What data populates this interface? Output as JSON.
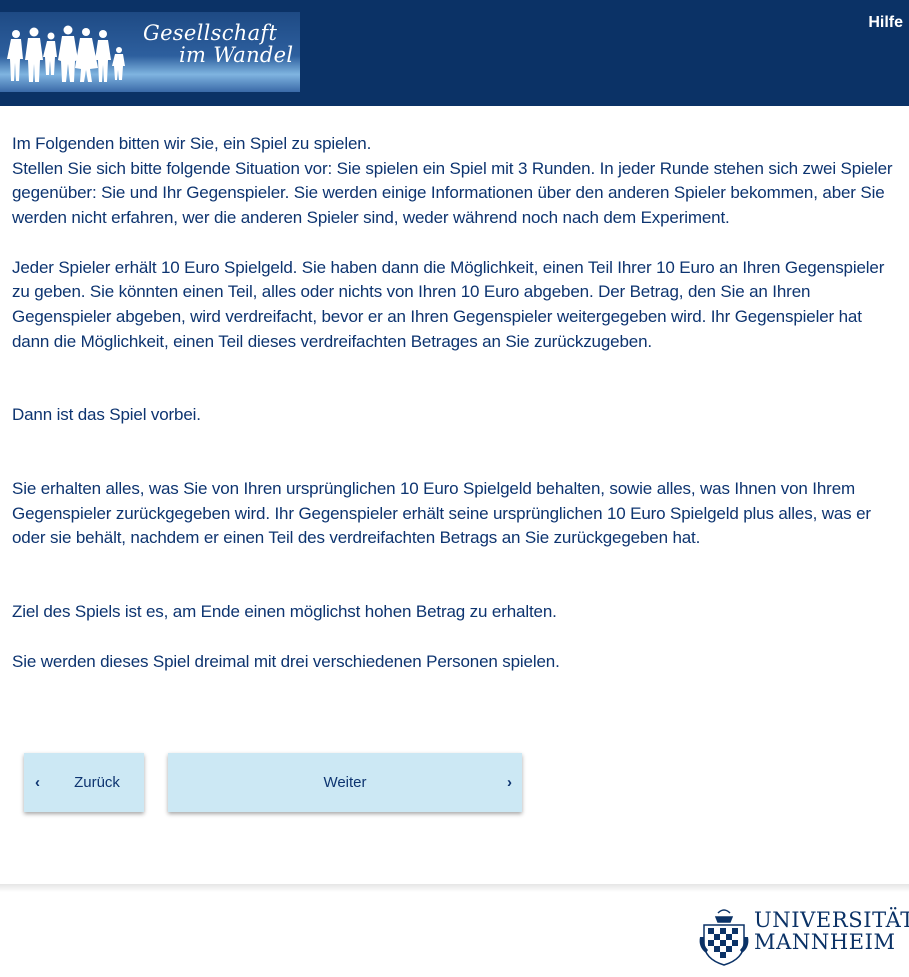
{
  "header": {
    "logo_line1": "Gesellschaft",
    "logo_line2": "im Wandel",
    "help_link": "Hilfe"
  },
  "content": {
    "p1": "Im Folgenden bitten wir Sie, ein Spiel zu spielen.",
    "p2": "Stellen Sie sich bitte folgende Situation vor: Sie spielen ein Spiel mit 3 Runden. In jeder Runde stehen sich zwei Spieler gegenüber: Sie und Ihr Gegenspieler. Sie werden einige Informationen über den anderen Spieler bekommen, aber Sie werden nicht erfahren, wer die anderen Spieler sind, weder während noch nach dem Experiment.",
    "p3": "Jeder Spieler erhält 10 Euro Spielgeld. Sie haben dann die Möglichkeit, einen Teil Ihrer 10 Euro an Ihren Gegenspieler zu geben. Sie könnten einen Teil, alles oder nichts von Ihren 10 Euro abgeben. Der Betrag, den Sie an Ihren Gegenspieler abgeben, wird verdreifacht, bevor er an Ihren Gegenspieler weitergegeben wird. Ihr Gegenspieler hat dann die Möglichkeit, einen Teil dieses verdreifachten Betrages an Sie zurückzugeben.",
    "p4": "Dann ist das Spiel vorbei.",
    "p5": "Sie erhalten alles, was Sie von Ihren ursprünglichen 10 Euro Spielgeld behalten, sowie alles, was Ihnen von Ihrem Gegenspieler zurückgegeben wird. Ihr Gegenspieler erhält seine ursprünglichen 10 Euro Spielgeld plus alles, was er oder sie behält, nachdem er einen Teil des verdreifachten Betrags an Sie zurückgegeben hat.",
    "p6": "Ziel des Spiels ist es, am Ende einen möglichst hohen Betrag zu erhalten.",
    "p7": "Sie werden dieses Spiel dreimal mit drei verschiedenen Personen spielen."
  },
  "nav": {
    "back_label": "Zurück",
    "next_label": "Weiter"
  },
  "footer": {
    "uni_line1": "UNIVERSITÄT",
    "uni_line2": "MANNHEIM"
  },
  "icons": {
    "back": "chevron-left-icon",
    "next": "chevron-right-icon",
    "logo": "family-silhouettes",
    "crest": "university-crest"
  },
  "colors": {
    "header_bg": "#0b3266",
    "text": "#0d3470",
    "button_bg": "#cce8f4"
  }
}
